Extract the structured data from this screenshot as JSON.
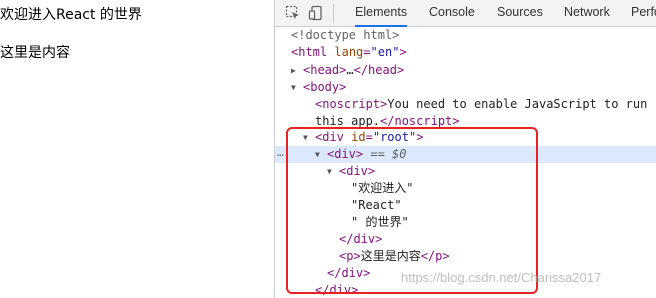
{
  "page": {
    "heading": "欢迎进入React 的世界",
    "paragraph": "这里是内容"
  },
  "toolbar": {
    "tabs": [
      "Elements",
      "Console",
      "Sources",
      "Network",
      "Perfo"
    ],
    "active_tab": "Elements",
    "icons": [
      "inspect-element-icon",
      "device-toggle-icon"
    ],
    "accent_color": "#1a73e8"
  },
  "dom": {
    "doctype": "<!doctype html>",
    "html_tag": "html",
    "html_attr": "lang",
    "html_val": "\"en\"",
    "head_open": "<head>",
    "head_ellipsis": "…",
    "head_close": "</head>",
    "body_open": "<body>",
    "noscript_open": "<noscript>",
    "noscript_text1": "You need to enable JavaScript to run",
    "noscript_text2": "this app.",
    "noscript_close": "</noscript>",
    "root_tag": "div",
    "root_attr": "id",
    "root_val": "\"root\"",
    "inner_div_open": "<div>",
    "selected_marker": "== $0",
    "row_dots": "…",
    "div_open": "<div>",
    "text1": "\"欢迎进入\"",
    "text2": "\"React\"",
    "text3": "\" 的世界\"",
    "div_close": "</div>",
    "p_open": "<p>",
    "p_text": "这里是内容",
    "p_close": "</p>",
    "inner_div_close": "</div>",
    "root_close": "</div>"
  },
  "highlight_color": "#e62222",
  "watermark": "https://blog.csdn.net/Charissa2017"
}
